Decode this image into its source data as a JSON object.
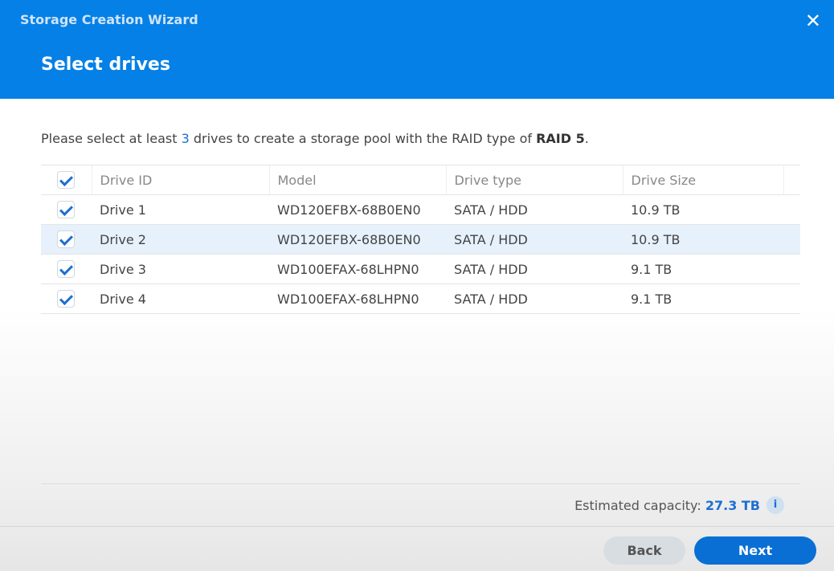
{
  "window": {
    "title": "Storage Creation Wizard",
    "close": "✕"
  },
  "page": {
    "title": "Select drives"
  },
  "instruction": {
    "pre": "Please select at least ",
    "count": "3",
    "mid": " drives to create a storage pool with the RAID type of ",
    "raid": "RAID 5",
    "post": "."
  },
  "table": {
    "headers": [
      "Drive ID",
      "Model",
      "Drive type",
      "Drive Size"
    ],
    "rows": [
      {
        "id": "Drive 1",
        "model": "WD120EFBX-68B0EN0",
        "type": "SATA / HDD",
        "size": "10.9 TB"
      },
      {
        "id": "Drive 2",
        "model": "WD120EFBX-68B0EN0",
        "type": "SATA / HDD",
        "size": "10.9 TB"
      },
      {
        "id": "Drive 3",
        "model": "WD100EFAX-68LHPN0",
        "type": "SATA / HDD",
        "size": "9.1 TB"
      },
      {
        "id": "Drive 4",
        "model": "WD100EFAX-68LHPN0",
        "type": "SATA / HDD",
        "size": "9.1 TB"
      }
    ]
  },
  "capacity": {
    "label": "Estimated capacity: ",
    "value": "27.3 TB",
    "info": "i"
  },
  "buttons": {
    "back": "Back",
    "next": "Next"
  }
}
